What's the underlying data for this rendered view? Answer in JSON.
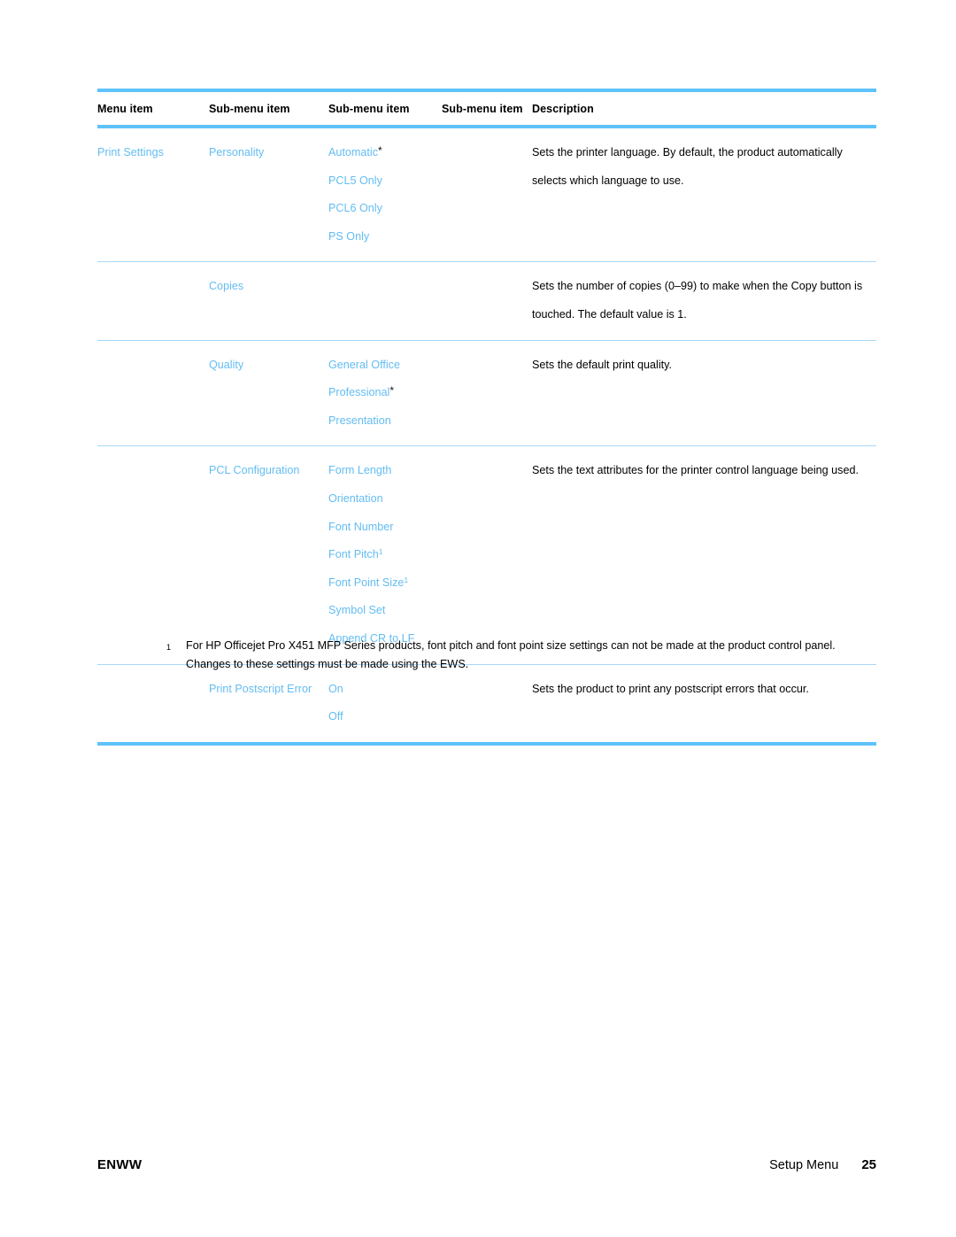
{
  "document": {
    "table": {
      "columns": [
        "Menu item",
        "Sub-menu item",
        "Sub-menu item",
        "Sub-menu item",
        "Description"
      ],
      "rows": [
        {
          "menu": "Print Settings",
          "sub1": "Personality",
          "sub2": [
            "Automatic*",
            "PCL5 Only",
            "PCL6 Only",
            "PS Only"
          ],
          "sub3": "",
          "description": "Sets the printer language. By default, the product automatically selects which language to use."
        },
        {
          "menu": "",
          "sub1": "Copies",
          "sub2": [],
          "sub3": "",
          "description": "Sets the number of copies (0–99) to make when the Copy button is touched. The default value is 1."
        },
        {
          "menu": "",
          "sub1": "Quality",
          "sub2": [
            "General Office",
            "Professional*",
            "Presentation"
          ],
          "sub3": "",
          "description": "Sets the default print quality."
        },
        {
          "menu": "",
          "sub1": "PCL Configuration",
          "sub2": [
            "Form Length",
            "Orientation",
            "Font Number",
            "Font Pitch1",
            "Font Point Size1",
            "Symbol Set",
            "Append CR to LF"
          ],
          "sub3": "",
          "description": "Sets the text attributes for the printer control language being used."
        },
        {
          "menu": "",
          "sub1": "Print Postscript Error",
          "sub2": [
            "On",
            "Off"
          ],
          "sub3": "",
          "description": "Sets the product to print any postscript errors that occur."
        }
      ]
    },
    "footnote": {
      "marker": "1",
      "text": "For HP Officejet Pro X451 MFP Series products, font pitch and font point size settings can not be made at the product control panel. Changes to these settings must be made using the EWS."
    },
    "footer": {
      "left": "ENWW",
      "section": "Setup Menu",
      "page": "25"
    },
    "colors": {
      "rule_strong": "#5ec2fb",
      "rule_light": "#a9d8fb",
      "link_blue": "#63bdf2",
      "text": "#000000"
    }
  }
}
